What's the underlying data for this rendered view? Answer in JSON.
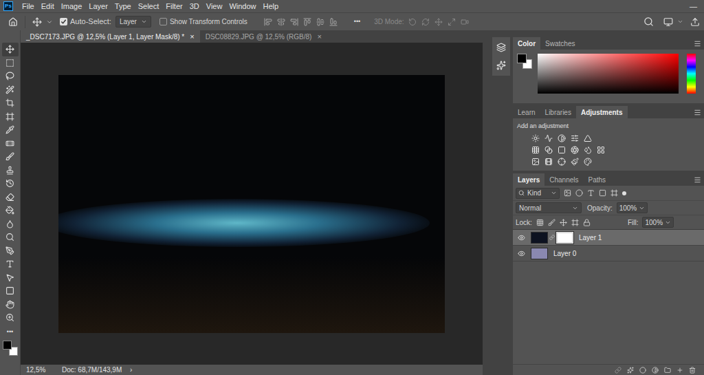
{
  "app": {
    "logo": "Ps",
    "window_controls": [
      "—"
    ]
  },
  "menu": [
    "File",
    "Edit",
    "Image",
    "Layer",
    "Type",
    "Select",
    "Filter",
    "3D",
    "View",
    "Window",
    "Help"
  ],
  "options_bar": {
    "auto_select": {
      "label": "Auto-Select:",
      "checked": true
    },
    "target": "Layer",
    "transform": {
      "label": "Show Transform Controls",
      "checked": false
    },
    "more": "•••",
    "mode_3d": {
      "label": "3D Mode:",
      "disabled": true
    }
  },
  "documents": [
    {
      "title": "_DSC7173.JPG @ 12,5% (Layer 1, Layer Mask/8) *",
      "close": "×",
      "selected": true
    },
    {
      "title": "DSC08829.JPG @ 12,5% (RGB/8)",
      "close": "×",
      "selected": false
    }
  ],
  "toolbar": {
    "more": "•••"
  },
  "status_bar": {
    "zoom": "12,5%",
    "doc": "Doc: 68,7M/143,9M",
    "arrow": "›"
  },
  "color_panel": {
    "tabs": [
      {
        "label": "Color",
        "selected": true
      },
      {
        "label": "Swatches",
        "selected": false
      }
    ],
    "foreground": "#000000",
    "background": "#ffffff"
  },
  "adjustments_panel": {
    "tabs": [
      {
        "label": "Learn",
        "selected": false
      },
      {
        "label": "Libraries",
        "selected": false
      },
      {
        "label": "Adjustments",
        "selected": true
      }
    ],
    "hint": "Add an adjustment"
  },
  "layers_panel": {
    "tabs": [
      {
        "label": "Layers",
        "selected": true
      },
      {
        "label": "Channels",
        "selected": false
      },
      {
        "label": "Paths",
        "selected": false
      }
    ],
    "filter": "Kind",
    "blend_mode": "Normal",
    "opacity": {
      "label": "Opacity:",
      "value": "100%"
    },
    "lock_label": "Lock:",
    "fill": {
      "label": "Fill:",
      "value": "100%"
    },
    "layers": [
      {
        "name": "Layer 1",
        "visible": true,
        "selected": true,
        "has_mask": true,
        "color": "#0d1220"
      },
      {
        "name": "Layer 0",
        "visible": true,
        "selected": false,
        "has_mask": false,
        "color": "#8a88b0"
      }
    ]
  }
}
